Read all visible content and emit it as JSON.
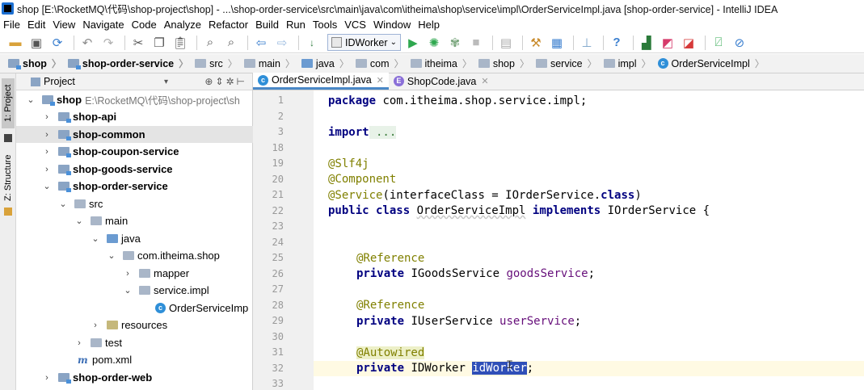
{
  "window": {
    "title": "shop [E:\\RocketMQ\\代码\\shop-project\\shop] - ...\\shop-order-service\\src\\main\\java\\com\\itheima\\shop\\service\\impl\\OrderServiceImpl.java [shop-order-service] - IntelliJ IDEA"
  },
  "menu": [
    "File",
    "Edit",
    "View",
    "Navigate",
    "Code",
    "Analyze",
    "Refactor",
    "Build",
    "Run",
    "Tools",
    "VCS",
    "Window",
    "Help"
  ],
  "toolbar": {
    "run_config": "IDWorker",
    "icons": [
      "open-icon",
      "save-icon",
      "sync-icon",
      "back-icon",
      "forward-icon",
      "cut-icon",
      "copy-icon",
      "paste-icon",
      "find-icon",
      "replace-icon",
      "nav-back-icon",
      "nav-forward-icon",
      "build-icon",
      "run-icon",
      "debug-icon",
      "coverage-icon",
      "stop-icon",
      "layout-icon",
      "project-structure-icon",
      "sdk-icon",
      "vcs-icon",
      "help-icon",
      "plugin-icon",
      "tool1-icon",
      "tool2-icon",
      "activity-icon",
      "block-icon"
    ]
  },
  "breadcrumbs": [
    "shop",
    "shop-order-service",
    "src",
    "main",
    "java",
    "com",
    "itheima",
    "shop",
    "service",
    "impl",
    "OrderServiceImpl"
  ],
  "sidebar": {
    "project_tab": "1: Project",
    "structure_tab": "Z: Structure"
  },
  "project_panel": {
    "header": "Project",
    "tree": [
      {
        "label": "shop",
        "path": "E:\\RocketMQ\\代码\\shop-project\\sh",
        "arrow": "v",
        "bold": true
      },
      {
        "label": "shop-api",
        "arrow": ">",
        "bold": true
      },
      {
        "label": "shop-common",
        "arrow": ">",
        "bold": true
      },
      {
        "label": "shop-coupon-service",
        "arrow": ">",
        "bold": true
      },
      {
        "label": "shop-goods-service",
        "arrow": ">",
        "bold": true
      },
      {
        "label": "shop-order-service",
        "arrow": "v",
        "bold": true
      },
      {
        "label": "src",
        "arrow": "v"
      },
      {
        "label": "main",
        "arrow": "v"
      },
      {
        "label": "java",
        "arrow": "v"
      },
      {
        "label": "com.itheima.shop",
        "arrow": "v"
      },
      {
        "label": "mapper",
        "arrow": ">"
      },
      {
        "label": "service.impl",
        "arrow": "v"
      },
      {
        "label": "OrderServiceImp",
        "arrow": ""
      },
      {
        "label": "resources",
        "arrow": ">"
      },
      {
        "label": "test",
        "arrow": ">"
      },
      {
        "label": "pom.xml",
        "arrow": ""
      },
      {
        "label": "shop-order-web",
        "arrow": ">",
        "bold": true
      }
    ]
  },
  "editor": {
    "tabs": [
      {
        "label": "OrderServiceImpl.java",
        "active": true
      },
      {
        "label": "ShopCode.java",
        "active": false
      }
    ],
    "line_numbers": [
      "1",
      "2",
      "3",
      "18",
      "19",
      "20",
      "21",
      "22",
      "23",
      "24",
      "25",
      "26",
      "27",
      "28",
      "29",
      "30",
      "31",
      "32",
      "33"
    ],
    "code": {
      "l1_kw": "package",
      "l1_rest": " com.itheima.shop.service.impl;",
      "l3_kw": "import",
      "l3_rest": " ...",
      "l19": "@Slf4j",
      "l20": "@Component",
      "l21_ann": "@Service",
      "l21_a": "(interfaceClass = IOrderService.",
      "l21_kw": "class",
      "l21_b": ")",
      "l22_kw1": "public class",
      "l22_name": "OrderServiceImpl",
      "l22_kw2": "implements",
      "l22_rest": " IOrderService {",
      "l25": "@Reference",
      "l26_kw": "private",
      "l26_type": " IGoodsService ",
      "l26_field": "goodsService",
      "l26_end": ";",
      "l28": "@Reference",
      "l29_kw": "private",
      "l29_type": " IUserService ",
      "l29_field": "userService",
      "l29_end": ";",
      "l31": "@Autowired",
      "l32_kw": "private",
      "l32_type": " IDWorker ",
      "l32_field": "idWorker",
      "l32_end": ";"
    }
  }
}
